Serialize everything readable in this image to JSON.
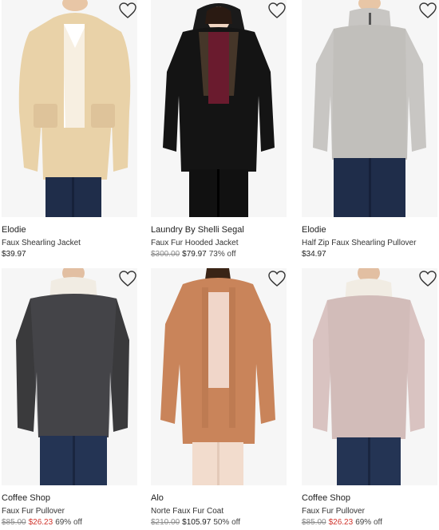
{
  "products": [
    {
      "brand": "Elodie",
      "title": "Faux Shearling Jacket",
      "price": "$39.97",
      "original_price": "",
      "discount": "",
      "image": "model-in-cream-faux-shearling-jacket",
      "colors": {
        "garment": "#e9d2a8",
        "shirt": "#ffffff",
        "pants": "#1f2d4a",
        "skin": "#e8c6a6",
        "hair": "#c8a27a"
      }
    },
    {
      "brand": "Laundry By Shelli Segal",
      "title": "Faux Fur Hooded Jacket",
      "price": "$79.97",
      "original_price": "$300.00",
      "discount": "73% off",
      "image": "model-in-black-faux-fur-hooded-jacket",
      "colors": {
        "garment": "#141414",
        "shirt": "#6a1b2e",
        "pants": "#111111",
        "skin": "#f0d5c2",
        "hair": "#2a1a12"
      }
    },
    {
      "brand": "Elodie",
      "title": "Half Zip Faux Shearling Pullover",
      "price": "$34.97",
      "original_price": "",
      "discount": "",
      "image": "model-in-grey-half-zip-pullover",
      "colors": {
        "garment": "#c8c6c3",
        "shirt": "#c8c6c3",
        "pants": "#1f2d4a",
        "skin": "#e8c6a6",
        "hair": "#8a6a4a"
      }
    },
    {
      "brand": "Coffee Shop",
      "title": "Faux Fur Pullover",
      "price": "$26.23",
      "original_price": "$85.00",
      "discount": "69% off",
      "image": "model-in-black-speckled-pullover",
      "colors": {
        "garment": "#3a3a3c",
        "shirt": "#f1ece3",
        "pants": "#243454",
        "skin": "#e2bfa2",
        "hair": "#3a2a1a"
      }
    },
    {
      "brand": "Alo",
      "title": "Norte Faux Fur Coat",
      "price": "$105.97",
      "original_price": "$210.00",
      "discount": "50% off",
      "image": "model-in-camel-faux-fur-coat",
      "colors": {
        "garment": "#c9845a",
        "shirt": "#f0d6c9",
        "pants": "#f2dccd",
        "skin": "#e6c2a6",
        "hair": "#3a2416"
      }
    },
    {
      "brand": "Coffee Shop",
      "title": "Faux Fur Pullover",
      "price": "$26.23",
      "original_price": "$85.00",
      "discount": "69% off",
      "image": "model-in-blush-speckled-pullover",
      "colors": {
        "garment": "#d9c3c1",
        "shirt": "#f1ece3",
        "pants": "#243454",
        "skin": "#e2bfa2",
        "hair": "#3a2a1a"
      }
    }
  ],
  "icons": {
    "wishlist": "heart-outline-icon"
  },
  "accent": {
    "sale_red": "#d0342c"
  }
}
